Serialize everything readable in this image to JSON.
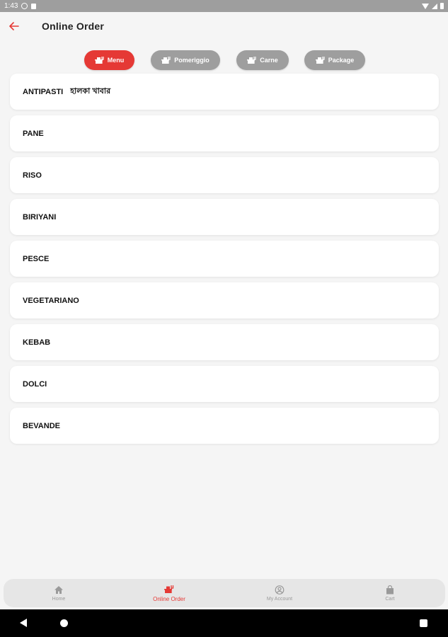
{
  "status_bar": {
    "time": "1:43"
  },
  "header": {
    "title": "Online Order"
  },
  "tabs": [
    {
      "label": "Menu",
      "active": true
    },
    {
      "label": "Pomeriggio",
      "active": false
    },
    {
      "label": "Carne",
      "active": false
    },
    {
      "label": "Package",
      "active": false
    }
  ],
  "categories": [
    {
      "label": "ANTIPASTI",
      "sub": "হালকা খাবার"
    },
    {
      "label": "PANE"
    },
    {
      "label": "RISO"
    },
    {
      "label": "BIRIYANI"
    },
    {
      "label": "PESCE"
    },
    {
      "label": "VEGETARIANO"
    },
    {
      "label": "KEBAB"
    },
    {
      "label": "DOLCI"
    },
    {
      "label": "BEVANDE"
    }
  ],
  "bottom_nav": [
    {
      "label": "Home",
      "icon": "home-icon",
      "active": false
    },
    {
      "label": "Online Order",
      "icon": "order-icon",
      "active": true
    },
    {
      "label": "My Account",
      "icon": "account-icon",
      "active": false
    },
    {
      "label": "Cart",
      "icon": "cart-icon",
      "active": false
    }
  ],
  "colors": {
    "accent": "#e53935",
    "inactive_tab": "#9e9e9e"
  }
}
